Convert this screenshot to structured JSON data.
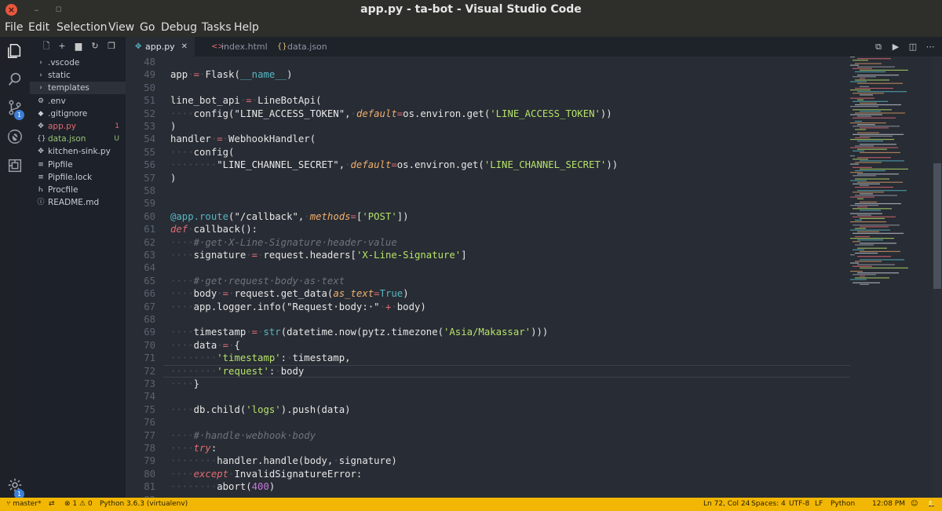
{
  "window": {
    "title": "app.py - ta-bot - Visual Studio Code"
  },
  "menu": [
    "File",
    "Edit",
    "Selection",
    "View",
    "Go",
    "Debug",
    "Tasks",
    "Help"
  ],
  "activity": {
    "scm_badge": "1",
    "settings_badge": "1"
  },
  "explorer": {
    "items": [
      {
        "label": ".vscode",
        "icon": "chevron-right-icon",
        "glyph": "›",
        "color": "#c7ccd4",
        "status": ""
      },
      {
        "label": "static",
        "icon": "chevron-right-icon",
        "glyph": "›",
        "color": "#c7ccd4",
        "status": ""
      },
      {
        "label": "templates",
        "icon": "chevron-right-icon",
        "glyph": "›",
        "color": "#c7ccd4",
        "status": "",
        "selected": true
      },
      {
        "label": ".env",
        "icon": "gear-file-icon",
        "glyph": "⚙",
        "color": "#c7ccd4",
        "status": ""
      },
      {
        "label": ".gitignore",
        "icon": "git-file-icon",
        "glyph": "◆",
        "color": "#c7ccd4",
        "status": ""
      },
      {
        "label": "app.py",
        "icon": "python-file-icon",
        "glyph": "✥",
        "color": "#e06c75",
        "status": "1",
        "status_color": "#e06c75"
      },
      {
        "label": "data.json",
        "icon": "json-file-icon",
        "glyph": "{}",
        "color": "#98c379",
        "status": "U",
        "status_color": "#98c379"
      },
      {
        "label": "kitchen-sink.py",
        "icon": "python-file-icon",
        "glyph": "✥",
        "color": "#c7ccd4",
        "status": ""
      },
      {
        "label": "Pipfile",
        "icon": "file-icon",
        "glyph": "≡",
        "color": "#c7ccd4",
        "status": ""
      },
      {
        "label": "Pipfile.lock",
        "icon": "file-icon",
        "glyph": "≡",
        "color": "#c7ccd4",
        "status": ""
      },
      {
        "label": "Procfile",
        "icon": "procfile-icon",
        "glyph": "Ꮒ",
        "color": "#c7ccd4",
        "status": ""
      },
      {
        "label": "README.md",
        "icon": "info-icon",
        "glyph": "ⓘ",
        "color": "#c7ccd4",
        "status": ""
      }
    ]
  },
  "tabs": [
    {
      "label": "app.py",
      "icon": "python-file-icon",
      "glyph": "✥",
      "active": true
    },
    {
      "label": "index.html",
      "icon": "html-file-icon",
      "glyph": "<>",
      "active": false
    },
    {
      "label": "data.json",
      "icon": "json-file-icon",
      "glyph": "{}",
      "active": false
    }
  ],
  "editor": {
    "current_line": 72,
    "lines": [
      {
        "n": "48",
        "html": ""
      },
      {
        "n": "49",
        "html": "app<span class='ws'>·</span><span class='op'>=</span><span class='ws'>·</span>Flask(<span class='bi'>__name__</span>)"
      },
      {
        "n": "50",
        "html": ""
      },
      {
        "n": "51",
        "html": "line_bot_api<span class='ws'>·</span><span class='op'>=</span><span class='ws'>·</span>LineBotApi("
      },
      {
        "n": "52",
        "html": "<span class='ws'>····</span>config(<span class='str'>\"LINE_ACCESS_TOKEN\"</span>,<span class='ws'>·</span><span class='pm'>default</span><span class='op'>=</span>os.environ.get(<span class='sq'>'LINE_ACCESS_TOKEN'</span>))"
      },
      {
        "n": "53",
        "html": ")"
      },
      {
        "n": "54",
        "html": "handler<span class='ws'>·</span><span class='op'>=</span><span class='ws'>·</span>WebhookHandler("
      },
      {
        "n": "55",
        "html": "<span class='ws'>····</span>config("
      },
      {
        "n": "56",
        "html": "<span class='ws'>········</span><span class='str'>\"LINE_CHANNEL_SECRET\"</span>,<span class='ws'>·</span><span class='pm'>default</span><span class='op'>=</span>os.environ.get(<span class='sq'>'LINE_CHANNEL_SECRET'</span>))"
      },
      {
        "n": "57",
        "html": ")"
      },
      {
        "n": "58",
        "html": ""
      },
      {
        "n": "59",
        "html": ""
      },
      {
        "n": "60",
        "html": "<span class='dec'>@app.route</span>(<span class='str'>\"/callback\"</span>,<span class='ws'>·</span><span class='pm'>methods</span><span class='op'>=</span>[<span class='sq'>'POST'</span>])"
      },
      {
        "n": "61",
        "html": "<span class='kw'>def</span><span class='ws'>·</span>callback():"
      },
      {
        "n": "62",
        "html": "<span class='ws'>····</span><span class='cm'>#·get·X-Line-Signature·header·value</span>"
      },
      {
        "n": "63",
        "html": "<span class='ws'>····</span>signature<span class='ws'>·</span><span class='op'>=</span><span class='ws'>·</span>request.headers[<span class='sq'>'X-Line-Signature'</span>]"
      },
      {
        "n": "64",
        "html": ""
      },
      {
        "n": "65",
        "html": "<span class='ws'>····</span><span class='cm'>#·get·request·body·as·text</span>"
      },
      {
        "n": "66",
        "html": "<span class='ws'>····</span>body<span class='ws'>·</span><span class='op'>=</span><span class='ws'>·</span>request.get_data(<span class='pm'>as_text</span><span class='op'>=</span><span class='tru'>True</span>)"
      },
      {
        "n": "67",
        "html": "<span class='ws'>····</span>app.logger.info(<span class='str'>\"Request·body:·\"</span><span class='ws'>·</span><span class='op'>+</span><span class='ws'>·</span>body)"
      },
      {
        "n": "68",
        "html": ""
      },
      {
        "n": "69",
        "html": "<span class='ws'>····</span>timestamp<span class='ws'>·</span><span class='op'>=</span><span class='ws'>·</span><span class='bi'>str</span>(datetime.now(pytz.timezone(<span class='sq'>'Asia/Makassar'</span>)))"
      },
      {
        "n": "70",
        "html": "<span class='ws'>····</span>data<span class='ws'>·</span><span class='op'>=</span><span class='ws'>·</span>{"
      },
      {
        "n": "71",
        "html": "<span class='ws'>········</span><span class='sq'>'timestamp'</span>:<span class='ws'>·</span>timestamp,"
      },
      {
        "n": "72",
        "html": "<span class='ws'>········</span><span class='sq'>'request'</span>:<span class='ws'>·</span>body"
      },
      {
        "n": "73",
        "html": "<span class='ws'>····</span>}"
      },
      {
        "n": "74",
        "html": ""
      },
      {
        "n": "75",
        "html": "<span class='ws'>····</span>db.child(<span class='sq'>'logs'</span>).push(data)"
      },
      {
        "n": "76",
        "html": ""
      },
      {
        "n": "77",
        "html": "<span class='ws'>····</span><span class='cm'>#·handle·webhook·body</span>"
      },
      {
        "n": "78",
        "html": "<span class='ws'>····</span><span class='kw'>try</span>:"
      },
      {
        "n": "79",
        "html": "<span class='ws'>········</span>handler.handle(body,<span class='ws'>·</span>signature)"
      },
      {
        "n": "80",
        "html": "<span class='ws'>····</span><span class='kw'>except</span><span class='ws'>·</span>InvalidSignatureError:"
      },
      {
        "n": "81",
        "html": "<span class='ws'>········</span>abort(<span class='num'>400</span>)"
      },
      {
        "n": "82",
        "html": ""
      }
    ]
  },
  "statusbar": {
    "branch": "master*",
    "errors": "1",
    "warnings": "0",
    "interpreter": "Python 3.6.3 (virtualenv)",
    "position": "Ln 72, Col 24",
    "indent": "Spaces: 4",
    "encoding": "UTF-8",
    "eol": "LF",
    "language": "Python",
    "time": "12:08 PM"
  },
  "colors": {
    "accent": "#f2b705",
    "editor_bg": "#282c34",
    "sidebar_bg": "#1d2129"
  }
}
